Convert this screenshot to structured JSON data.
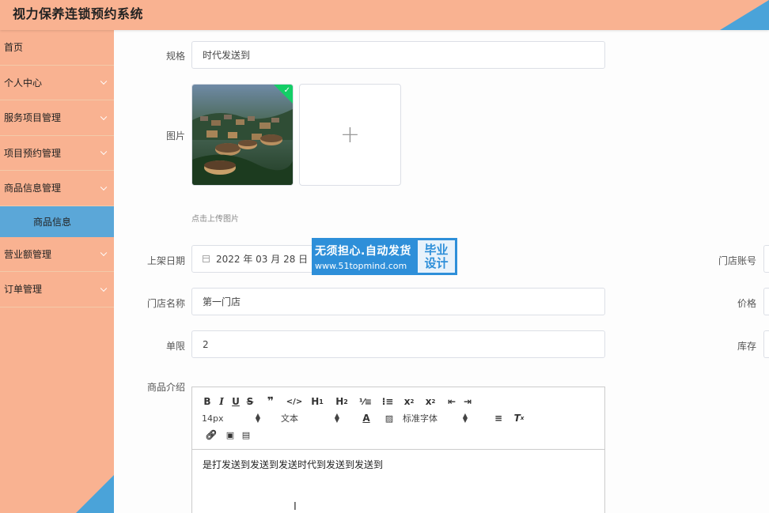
{
  "app": {
    "title": "视力保养连锁预约系统"
  },
  "sidebar": {
    "items": [
      {
        "label": "首页"
      },
      {
        "label": "个人中心"
      },
      {
        "label": "服务项目管理"
      },
      {
        "label": "项目预约管理"
      },
      {
        "label": "商品信息管理"
      },
      {
        "label": "商品信息"
      },
      {
        "label": "营业额管理"
      },
      {
        "label": "订单管理"
      }
    ]
  },
  "form": {
    "spec": {
      "label": "规格",
      "value": "时代发送到"
    },
    "image": {
      "label": "图片",
      "hint": "点击上传图片",
      "add_glyph": "+"
    },
    "shelf_date": {
      "label": "上架日期",
      "value": "2022 年 03 月 28 日"
    },
    "store_account": {
      "label": "门店账号"
    },
    "store_name": {
      "label": "门店名称",
      "value": "第一门店"
    },
    "price": {
      "label": "价格"
    },
    "limit": {
      "label": "单限",
      "value": "2"
    },
    "stock": {
      "label": "库存"
    },
    "intro": {
      "label": "商品介绍"
    }
  },
  "editor": {
    "font_size": "14px",
    "block_type": "文本",
    "font_family": "标准字体",
    "content": "是打发送到发送到发送时代到发送到发送到"
  },
  "watermark": {
    "line1": "无须担心.自动发货",
    "line2": "www.51topmind.com",
    "badge1": "毕业",
    "badge2": "设计"
  },
  "colors": {
    "header_bg": "#f9b291",
    "sidebar_active": "#5ba7d8",
    "accent_blue": "#4aa3d9",
    "check_green": "#13ce66"
  }
}
